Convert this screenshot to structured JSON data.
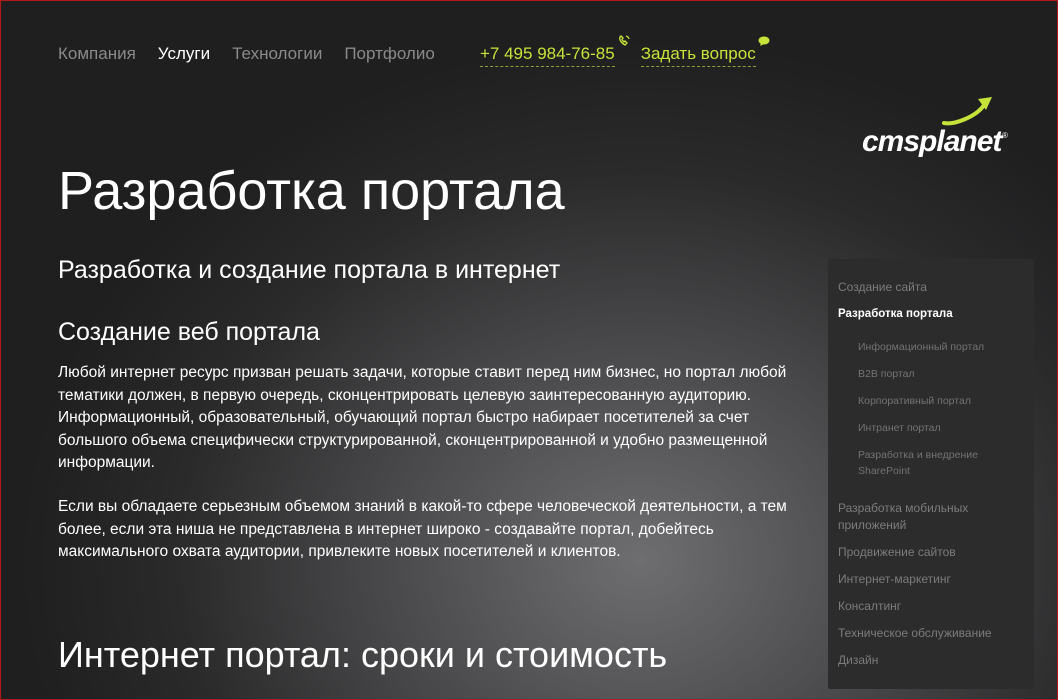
{
  "nav": {
    "items": [
      {
        "label": "Компания",
        "active": false
      },
      {
        "label": "Услуги",
        "active": true
      },
      {
        "label": "Технологии",
        "active": false
      },
      {
        "label": "Портфолио",
        "active": false
      }
    ]
  },
  "contact": {
    "phone": "+7 495 984-76-85",
    "ask": "Задать вопрос"
  },
  "logo": {
    "text": "cmsplanet",
    "reg": "®"
  },
  "content": {
    "title": "Разработка портала",
    "subtitle": "Разработка и создание портала в интернет",
    "section_title": "Создание веб портала",
    "paragraph1": "Любой интернет ресурс призван решать задачи, которые ставит перед ним бизнес, но портал любой тематики должен, в первую очередь, сконцентрировать целевую заинтересованную аудиторию. Информационный, образовательный, обучающий портал быстро набирает посетителей за счет большого объема специфически структурированной, сконцентрированной и удобно размещенной информации.",
    "paragraph2": "Если вы обладаете серьезным объемом знаний в какой-то сфере человеческой деятельности, а тем более, если эта ниша не представлена в интернет широко - создавайте портал, добейтесь максимального охвата аудитории, привлеките новых  посетителей и клиентов.",
    "bottom_title": "Интернет портал: сроки и стоимость"
  },
  "sidebar": {
    "items": [
      {
        "label": "Создание сайта"
      },
      {
        "label": "Разработка портала"
      },
      {
        "label": "Информационный портал"
      },
      {
        "label": "B2B портал"
      },
      {
        "label": "Корпоративный портал"
      },
      {
        "label": "Интранет портал"
      },
      {
        "label": "Разработка и внедрение SharePoint"
      },
      {
        "label": "Разработка мобильных приложений"
      },
      {
        "label": "Продвижение сайтов"
      },
      {
        "label": "Интернет-маркетинг"
      },
      {
        "label": "Консалтинг"
      },
      {
        "label": "Техническое обслуживание"
      },
      {
        "label": "Дизайн"
      }
    ]
  },
  "colors": {
    "accent": "#c6e33a",
    "nav_inactive": "#8a8a8a",
    "sidebar_bg": "#2c2c2d"
  }
}
